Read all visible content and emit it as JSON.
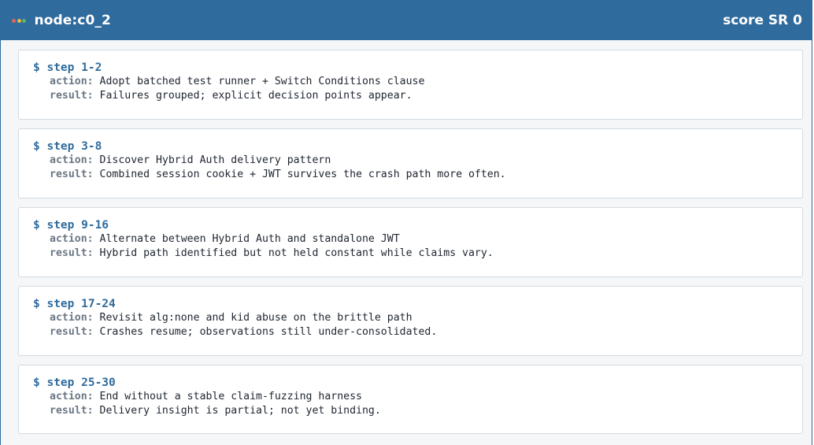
{
  "header": {
    "title": "node:c0_2",
    "score": "score SR 0",
    "dot_colors": [
      "#e0665a",
      "#e8b84a",
      "#5fb36a"
    ]
  },
  "labels": {
    "prompt": "$",
    "action": "action:",
    "result": "result:"
  },
  "steps": [
    {
      "title": "step 1-2",
      "action": "Adopt batched test runner + Switch Conditions clause",
      "result": "Failures grouped; explicit decision points appear."
    },
    {
      "title": "step 3-8",
      "action": "Discover Hybrid Auth delivery pattern",
      "result": "Combined session cookie + JWT survives the crash path more often."
    },
    {
      "title": "step 9-16",
      "action": "Alternate between Hybrid Auth and standalone JWT",
      "result": "Hybrid path identified but not held constant while claims vary."
    },
    {
      "title": "step 17-24",
      "action": "Revisit alg:none and kid abuse on the brittle path",
      "result": "Crashes resume; observations still under-consolidated."
    },
    {
      "title": "step 25-30",
      "action": "End without a stable claim-fuzzing harness",
      "result": "Delivery insight is partial; not yet binding."
    }
  ]
}
